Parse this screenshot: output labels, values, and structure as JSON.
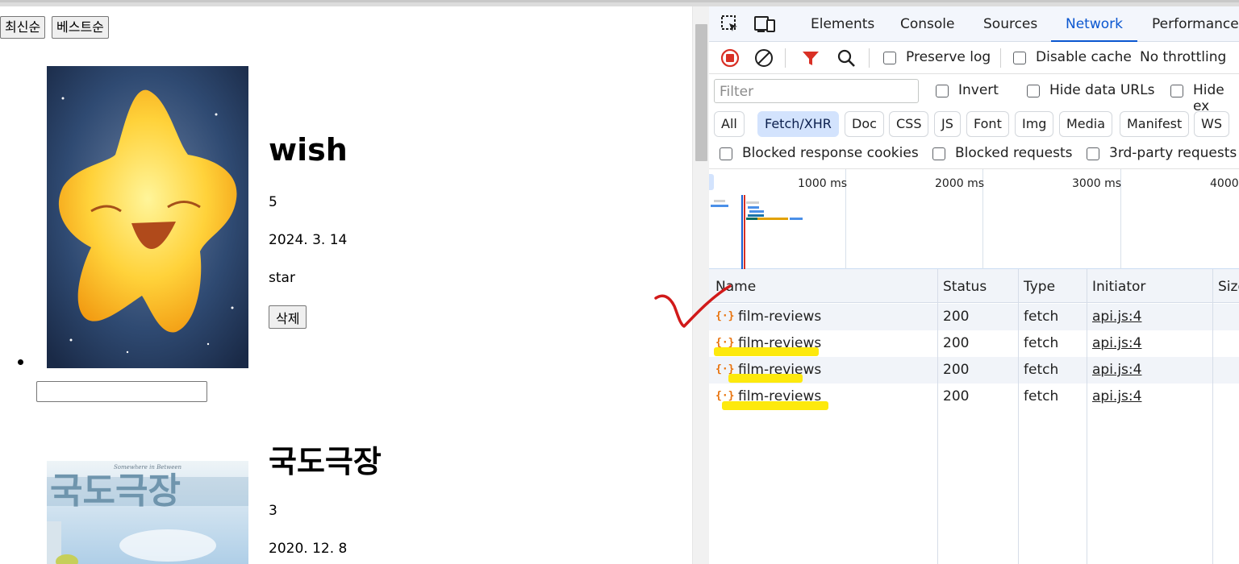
{
  "page": {
    "sort_buttons": [
      "최신순",
      "베스트순"
    ],
    "movies": [
      {
        "title": "wish",
        "rating": "5",
        "date": "2024. 3. 14",
        "comment": "star",
        "delete_label": "삭제"
      },
      {
        "title": "국도극장",
        "rating": "3",
        "date": "2020. 12. 8"
      }
    ],
    "poster2_overlay_text": "국도극장",
    "poster2_small_text": "Somewhere in Between"
  },
  "devtools": {
    "tabs": [
      "Elements",
      "Console",
      "Sources",
      "Network",
      "Performance"
    ],
    "active_tab": "Network",
    "toolbar": {
      "preserve_log": "Preserve log",
      "disable_cache": "Disable cache",
      "throttling": "No throttling"
    },
    "filter": {
      "placeholder": "Filter",
      "invert": "Invert",
      "hide_data_urls": "Hide data URLs",
      "hide_extension": "Hide ex"
    },
    "types": [
      "All",
      "Fetch/XHR",
      "Doc",
      "CSS",
      "JS",
      "Font",
      "Img",
      "Media",
      "Manifest",
      "WS"
    ],
    "active_type": "Fetch/XHR",
    "blocked": [
      "Blocked response cookies",
      "Blocked requests",
      "3rd-party requests"
    ],
    "overview_ticks": [
      "1000 ms",
      "2000 ms",
      "3000 ms",
      "4000"
    ],
    "columns": [
      "Name",
      "Status",
      "Type",
      "Initiator",
      "Size"
    ],
    "requests": [
      {
        "name": "film-reviews",
        "status": "200",
        "type": "fetch",
        "initiator": "api.js:4"
      },
      {
        "name": "film-reviews",
        "status": "200",
        "type": "fetch",
        "initiator": "api.js:4"
      },
      {
        "name": "film-reviews",
        "status": "200",
        "type": "fetch",
        "initiator": "api.js:4"
      },
      {
        "name": "film-reviews",
        "status": "200",
        "type": "fetch",
        "initiator": "api.js:4"
      }
    ]
  },
  "colors": {
    "accent": "#0b57d0",
    "record_red": "#d93025",
    "highlight": "#fde800",
    "annotation": "#d11a1a"
  }
}
